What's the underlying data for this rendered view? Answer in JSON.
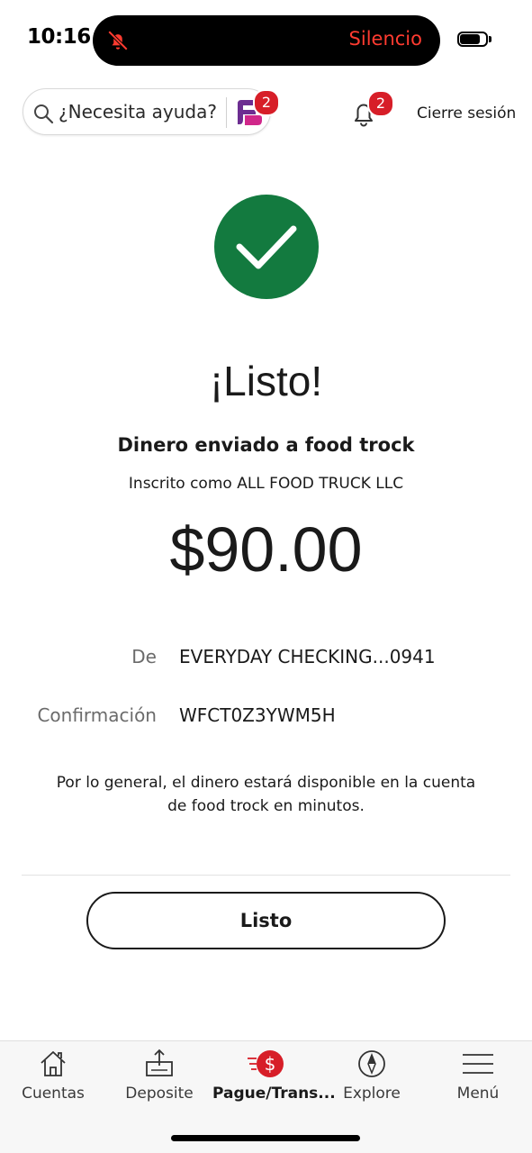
{
  "status_bar": {
    "time": "10:16",
    "mode": "Silencio"
  },
  "header": {
    "search_label": "¿Necesita ayuda?",
    "fargo_badge": "2",
    "notifications_badge": "2",
    "signout_label": "Cierre sesión"
  },
  "confirmation": {
    "title": "¡Listo!",
    "subtitle": "Dinero enviado a food trock",
    "enrolled_as": "Inscrito como ALL FOOD TRUCK LLC",
    "amount": "$90.00",
    "from_label": "De",
    "from_value": "EVERYDAY CHECKING...0941",
    "confirmation_label": "Confirmación",
    "confirmation_value": "WFCT0Z3YWM5H",
    "note": "Por lo general, el dinero estará disponible en la cuenta de food trock en minutos.",
    "done_label": "Listo"
  },
  "tabs": [
    {
      "label": "Cuentas",
      "icon": "house-icon",
      "active": false
    },
    {
      "label": "Deposite",
      "icon": "deposit-icon",
      "active": false
    },
    {
      "label": "Pague/Trans...",
      "icon": "pay-transfer-icon",
      "active": true
    },
    {
      "label": "Explore",
      "icon": "compass-icon",
      "active": false
    },
    {
      "label": "Menú",
      "icon": "hamburger-icon",
      "active": false
    }
  ],
  "colors": {
    "success_green": "#137a3f",
    "brand_red": "#d71e28",
    "fargo_purple": "#6c2d91",
    "silence_red": "#ff3b30"
  }
}
